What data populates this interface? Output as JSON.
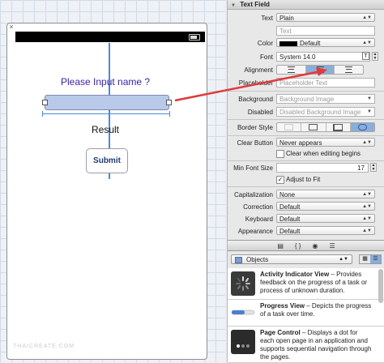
{
  "canvas": {
    "prompt": "Please Input name ?",
    "result": "Result",
    "submit": "Submit",
    "close_glyph": "×",
    "watermark": "THAICREATE.COM"
  },
  "inspector": {
    "section_title": "Text Field",
    "rows": {
      "text_label": "Text",
      "text_value": "Plain",
      "text_field_value": "Text",
      "color_label": "Color",
      "color_value": "Default",
      "font_label": "Font",
      "font_value": "System 14.0",
      "font_btn": "T",
      "alignment_label": "Alignment",
      "placeholder_label": "Placeholder",
      "placeholder_value": "Placeholder Text",
      "background_label": "Background",
      "background_value": "Background Image",
      "disabled_label": "Disabled",
      "disabled_value": "Disabled Background Image",
      "border_style_label": "Border Style",
      "clear_button_label": "Clear Button",
      "clear_button_value": "Never appears",
      "clear_editing_label": "Clear when editing begins",
      "min_font_label": "Min Font Size",
      "min_font_value": "17",
      "adjust_label": "Adjust to Fit",
      "capitalization_label": "Capitalization",
      "capitalization_value": "None",
      "correction_label": "Correction",
      "correction_value": "Default",
      "keyboard_label": "Keyboard",
      "keyboard_value": "Default",
      "appearance_label": "Appearance",
      "appearance_value": "Default"
    },
    "selected_alignment": "center",
    "selected_border_style": "rounded"
  },
  "library": {
    "tab_icons": [
      "document-icon",
      "braces-icon",
      "cube-icon",
      "list-icon"
    ],
    "tab_glyphs": [
      "▤",
      "{ }",
      "◉",
      "☰"
    ],
    "selector": "Objects",
    "items": [
      {
        "title": "Activity Indicator View",
        "desc": " – Provides feedback on the progress of a task or process of unknown duration."
      },
      {
        "title": "Progress View",
        "desc": " – Depicts the progress of a task over time."
      },
      {
        "title": "Page Control",
        "desc": " – Displays a dot for each open page in an application and supports sequential navigation through the pages."
      }
    ]
  },
  "colors": {
    "accent": "#8aaed8",
    "arrow": "#e03a3a",
    "prompt_text": "#3a1ea6",
    "guide": "#4a8ad8"
  }
}
